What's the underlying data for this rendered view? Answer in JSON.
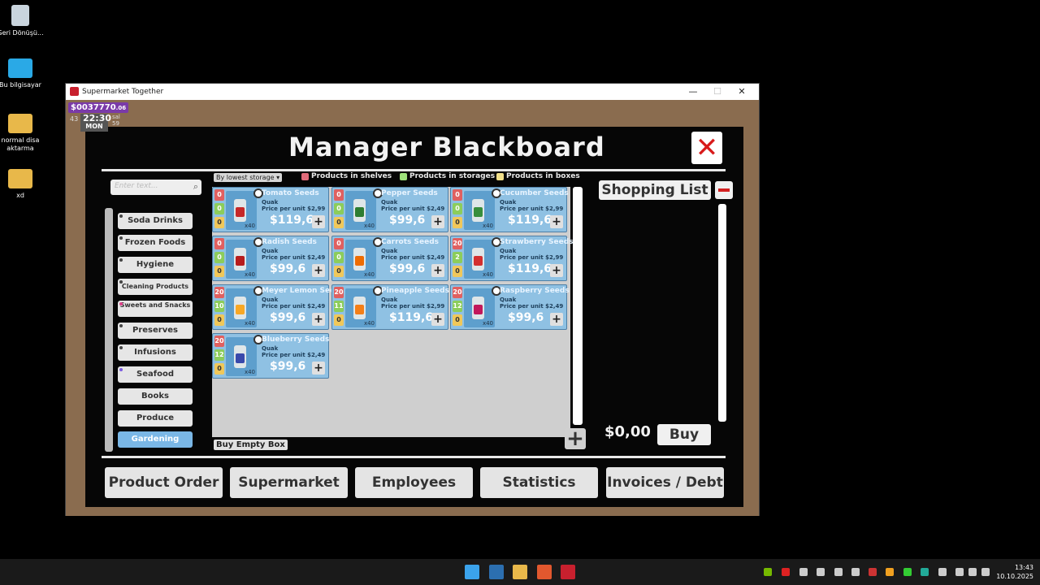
{
  "desktop": {
    "icons": [
      {
        "label": "Geri Dönüşü..."
      },
      {
        "label": "Bu bilgisayar"
      },
      {
        "label": "normal disa aktarma"
      },
      {
        "label": "xd"
      }
    ]
  },
  "window": {
    "title": "Supermarket Together",
    "minimize": "—",
    "maximize": "☐",
    "close": "✕"
  },
  "hud": {
    "money": "$0037770",
    "money_cents": ".06",
    "time": "22:30",
    "day": "MON",
    "left_num": "43",
    "right_top": "sal",
    "right_num": "59"
  },
  "board": {
    "title": "Manager Blackboard",
    "close_label": "✕",
    "search_placeholder": "Enter text...",
    "search_icon": "magnifier-icon",
    "sort_label": "By lowest storage",
    "legend": [
      {
        "label": "Products in shelves",
        "color": "#e06b7a"
      },
      {
        "label": "Products in storages",
        "color": "#9de07a"
      },
      {
        "label": "Products in boxes",
        "color": "#f2e08a"
      }
    ],
    "categories": [
      {
        "label": "Soda Drinks"
      },
      {
        "label": "Frozen Foods"
      },
      {
        "label": "Hygiene"
      },
      {
        "label": "Cleaning Products"
      },
      {
        "label": "Sweets and Snacks"
      },
      {
        "label": "Preserves"
      },
      {
        "label": "Infusions"
      },
      {
        "label": "Seafood"
      },
      {
        "label": "Books"
      },
      {
        "label": "Produce"
      },
      {
        "label": "Gardening"
      }
    ],
    "active_category": "Gardening",
    "products": [
      {
        "name": "Tomato Seeds",
        "brand": "Quak",
        "unit": "Price per unit $2,99",
        "price": "$119,6",
        "shelves": "0",
        "storage": "0",
        "boxes": "0",
        "qty": "x40",
        "color": "#c62828"
      },
      {
        "name": "Pepper Seeds",
        "brand": "Quak",
        "unit": "Price per unit $2,49",
        "price": "$99,6",
        "shelves": "0",
        "storage": "0",
        "boxes": "0",
        "qty": "x40",
        "color": "#2e7d32"
      },
      {
        "name": "Cucumber Seeds",
        "brand": "Quak",
        "unit": "Price per unit $2,99",
        "price": "$119,6",
        "shelves": "0",
        "storage": "0",
        "boxes": "0",
        "qty": "x40",
        "color": "#388e3c"
      },
      {
        "name": "Radish Seeds",
        "brand": "Quak",
        "unit": "Price per unit $2,49",
        "price": "$99,6",
        "shelves": "0",
        "storage": "0",
        "boxes": "0",
        "qty": "x40",
        "color": "#b71c1c"
      },
      {
        "name": "Carrots Seeds",
        "brand": "Quak",
        "unit": "Price per unit $2,49",
        "price": "$99,6",
        "shelves": "0",
        "storage": "0",
        "boxes": "0",
        "qty": "x40",
        "color": "#ef6c00"
      },
      {
        "name": "Strawberry Seeds",
        "brand": "Quak",
        "unit": "Price per unit $2,99",
        "price": "$119,6",
        "shelves": "20",
        "storage": "2",
        "boxes": "0",
        "qty": "x40",
        "color": "#d32f2f"
      },
      {
        "name": "Meyer Lemon Seeds",
        "brand": "Quak",
        "unit": "Price per unit $2,49",
        "price": "$99,6",
        "shelves": "20",
        "storage": "10",
        "boxes": "0",
        "qty": "x40",
        "color": "#f9a825"
      },
      {
        "name": "Pineapple Seeds",
        "brand": "Quak",
        "unit": "Price per unit $2,99",
        "price": "$119,6",
        "shelves": "20",
        "storage": "11",
        "boxes": "0",
        "qty": "x40",
        "color": "#f57f17"
      },
      {
        "name": "Raspberry Seeds",
        "brand": "Quak",
        "unit": "Price per unit $2,49",
        "price": "$99,6",
        "shelves": "20",
        "storage": "12",
        "boxes": "0",
        "qty": "x40",
        "color": "#c2185b"
      },
      {
        "name": "Blueberry Seeds",
        "brand": "Quak",
        "unit": "Price per unit $2,49",
        "price": "$99,6",
        "shelves": "20",
        "storage": "12",
        "boxes": "0",
        "qty": "x40",
        "color": "#3949ab"
      }
    ],
    "add_label": "+",
    "buy_empty_box": "Buy Empty Box",
    "shopping_list_title": "Shopping List",
    "total": "$0,00",
    "buy_label": "Buy",
    "nav": [
      {
        "label": "Product Order"
      },
      {
        "label": "Supermarket"
      },
      {
        "label": "Employees"
      },
      {
        "label": "Statistics"
      },
      {
        "label": "Invoices / Debt"
      }
    ]
  },
  "taskbar": {
    "time": "13:43",
    "date": "10.10.2025"
  }
}
